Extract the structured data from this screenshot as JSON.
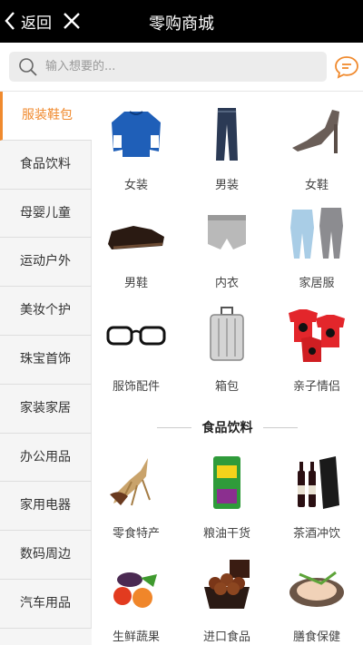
{
  "header": {
    "back_label": "返回",
    "title": "零购商城"
  },
  "search": {
    "placeholder": "输入想要的..."
  },
  "sidebar": {
    "items": [
      {
        "label": "服装鞋包",
        "active": true
      },
      {
        "label": "食品饮料"
      },
      {
        "label": "母婴儿童"
      },
      {
        "label": "运动户外"
      },
      {
        "label": "美妆个护"
      },
      {
        "label": "珠宝首饰"
      },
      {
        "label": "家装家居"
      },
      {
        "label": "办公用品"
      },
      {
        "label": "家用电器"
      },
      {
        "label": "数码周边"
      },
      {
        "label": "汽车用品"
      }
    ]
  },
  "apparel": {
    "items": [
      {
        "label": "女装",
        "icon": "sweater-icon"
      },
      {
        "label": "男装",
        "icon": "jeans-icon"
      },
      {
        "label": "女鞋",
        "icon": "high-heel-icon"
      },
      {
        "label": "男鞋",
        "icon": "leather-shoe-icon"
      },
      {
        "label": "内衣",
        "icon": "underwear-icon"
      },
      {
        "label": "家居服",
        "icon": "pajamas-icon"
      },
      {
        "label": "服饰配件",
        "icon": "glasses-icon"
      },
      {
        "label": "箱包",
        "icon": "suitcase-icon"
      },
      {
        "label": "亲子情侣",
        "icon": "family-tshirt-icon"
      }
    ]
  },
  "food": {
    "heading": "食品饮料",
    "items": [
      {
        "label": "零食特产",
        "icon": "ginseng-icon"
      },
      {
        "label": "粮油干货",
        "icon": "rice-bag-icon"
      },
      {
        "label": "茶酒冲饮",
        "icon": "wine-icon"
      },
      {
        "label": "生鲜蔬果",
        "icon": "vegetables-icon"
      },
      {
        "label": "进口食品",
        "icon": "meatballs-icon"
      },
      {
        "label": "膳食保健",
        "icon": "chicken-icon"
      }
    ]
  },
  "colors": {
    "accent": "#f08a2e",
    "topbar": "#000000"
  }
}
